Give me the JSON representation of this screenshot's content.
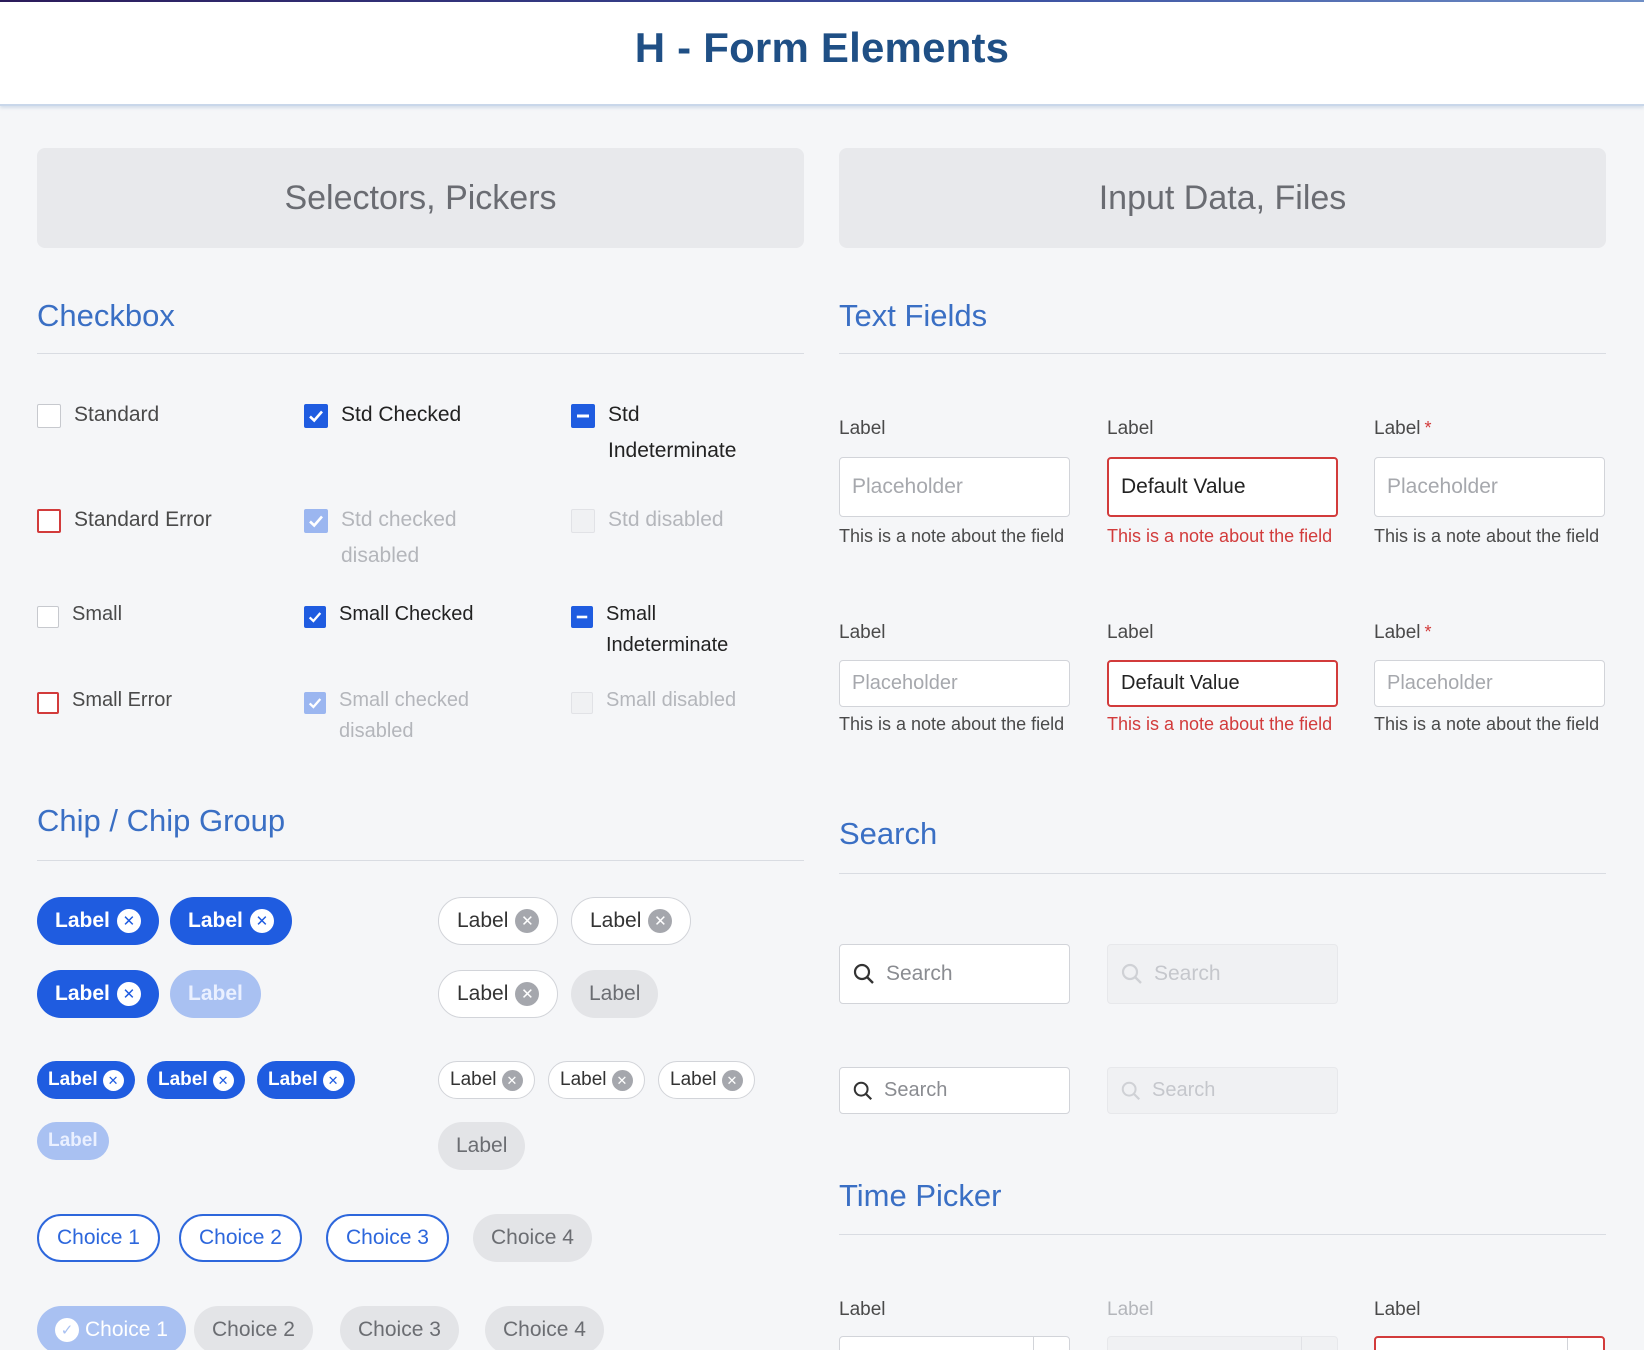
{
  "page": {
    "title": "H - Form Elements"
  },
  "banners": {
    "left": "Selectors, Pickers",
    "right": "Input Data, Files"
  },
  "checkbox": {
    "title": "Checkbox",
    "items": [
      "Standard",
      "Std Checked",
      "Std Indeterminate",
      "Standard Error",
      "Std checked disabled",
      "Std disabled",
      "Small",
      "Small Checked",
      "Small Indeterminate",
      "Small Error",
      "Small checked disabled",
      "Small disabled"
    ]
  },
  "chips": {
    "title": "Chip / Chip Group",
    "label": "Label",
    "choices": [
      "Choice 1",
      "Choice 2",
      "Choice 3",
      "Choice 4"
    ]
  },
  "text_fields": {
    "title": "Text Fields",
    "label": "Label",
    "required_mark": "*",
    "placeholder": "Placeholder",
    "default_value": "Default Value",
    "note": "This is a note about the field"
  },
  "search": {
    "title": "Search",
    "placeholder": "Search"
  },
  "time_picker": {
    "title": "Time Picker",
    "label": "Label"
  },
  "colors": {
    "primary": "#1f5ce0",
    "error": "#d23b3b",
    "heading": "#3a6fc4",
    "title": "#1f4f85"
  }
}
